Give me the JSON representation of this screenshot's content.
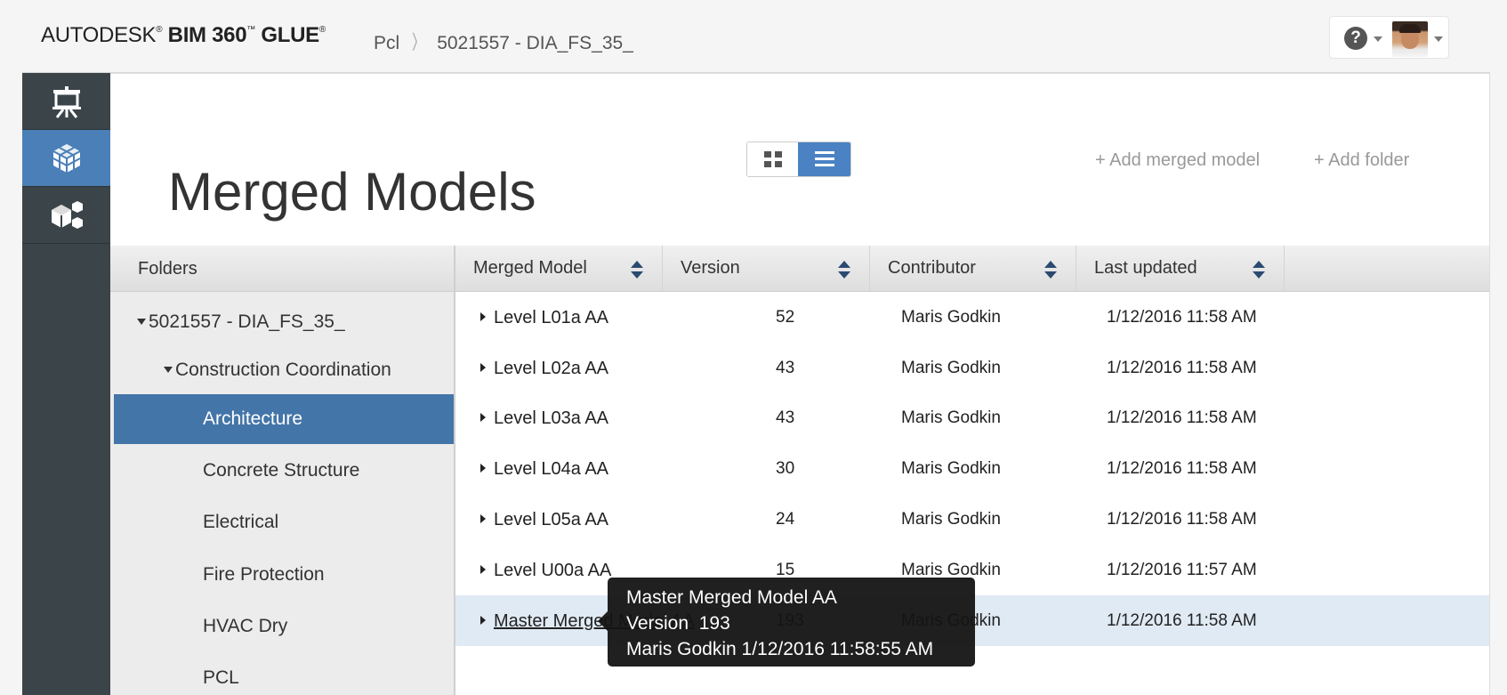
{
  "header": {
    "brand_autodesk": "AUTODESK",
    "brand_reg": "®",
    "brand_bim": "BIM 360",
    "brand_tm": "™",
    "brand_glue": "GLUE",
    "brand_reg2": "®",
    "breadcrumb": [
      {
        "label": "Pcl"
      },
      {
        "label": "5021557 - DIA_FS_35_"
      }
    ],
    "help_symbol": "?",
    "icons": {
      "help": "help-icon",
      "avatar": "user-avatar"
    }
  },
  "left_nav": {
    "items": [
      {
        "icon": "presentation-board-icon",
        "active": false
      },
      {
        "icon": "merged-model-cube-icon",
        "active": true
      },
      {
        "icon": "models-cubes-icon",
        "active": false
      }
    ],
    "accent": "#4a7fb8",
    "background": "#3a4449"
  },
  "page": {
    "title": "Merged Models",
    "add_merged_model": "+ Add merged model",
    "add_folder": "+ Add folder",
    "view_mode": "list"
  },
  "folders": {
    "header": "Folders",
    "items": [
      {
        "label": "5021557 - DIA_FS_35_",
        "level": 0,
        "expanded": true
      },
      {
        "label": "Construction Coordination",
        "level": 1,
        "expanded": true
      },
      {
        "label": "Architecture",
        "level": 2,
        "selected": true
      },
      {
        "label": "Concrete Structure",
        "level": 2
      },
      {
        "label": "Electrical",
        "level": 2
      },
      {
        "label": "Fire Protection",
        "level": 2
      },
      {
        "label": "HVAC Dry",
        "level": 2
      },
      {
        "label": "PCL",
        "level": 2
      }
    ]
  },
  "table": {
    "columns": [
      "Merged Model",
      "Version",
      "Contributor",
      "Last updated"
    ],
    "rows": [
      {
        "name": "Level L01a AA",
        "version": "52",
        "contributor": "Maris Godkin",
        "updated": "1/12/2016 11:58 AM"
      },
      {
        "name": "Level L02a AA",
        "version": "43",
        "contributor": "Maris Godkin",
        "updated": "1/12/2016 11:58 AM"
      },
      {
        "name": "Level L03a AA",
        "version": "43",
        "contributor": "Maris Godkin",
        "updated": "1/12/2016 11:58 AM"
      },
      {
        "name": "Level L04a AA",
        "version": "30",
        "contributor": "Maris Godkin",
        "updated": "1/12/2016 11:58 AM"
      },
      {
        "name": "Level L05a AA",
        "version": "24",
        "contributor": "Maris Godkin",
        "updated": "1/12/2016 11:58 AM"
      },
      {
        "name": "Level U00a AA",
        "version": "15",
        "contributor": "Maris Godkin",
        "updated": "1/12/2016 11:57 AM"
      },
      {
        "name": "Master Merged Model AA",
        "version": "193",
        "contributor": "Maris Godkin",
        "updated": "1/12/2016 11:58 AM",
        "hovered": true
      }
    ]
  },
  "tooltip": {
    "title": "Master Merged Model AA",
    "version_label": "Version",
    "version_value": "193",
    "contributor": "Maris Godkin",
    "timestamp": "1/12/2016 11:58:55 AM"
  }
}
